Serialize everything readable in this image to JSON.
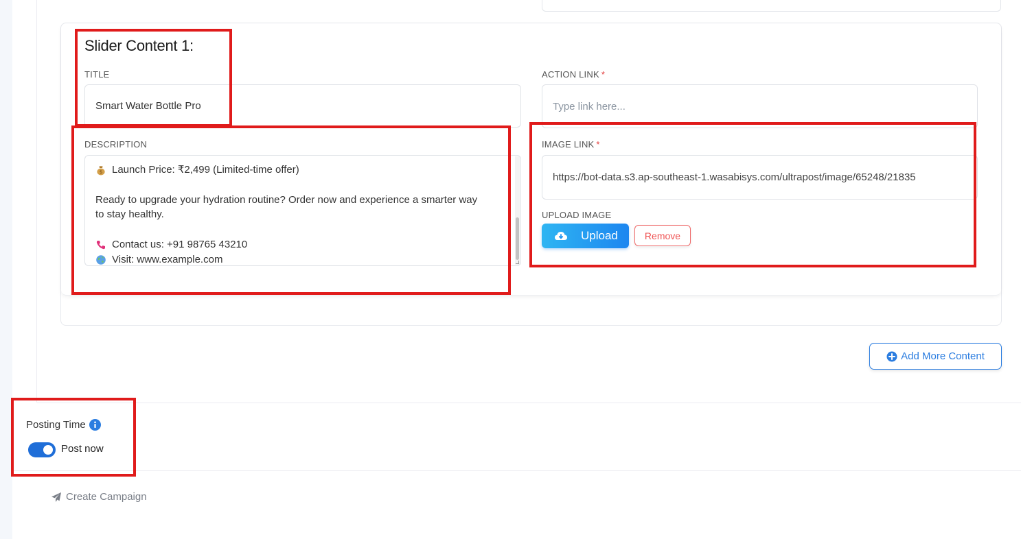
{
  "slider": {
    "heading": "Slider Content 1:",
    "title_label": "TITLE",
    "title_value": "Smart Water Bottle Pro",
    "action_link_label": "ACTION LINK",
    "action_link_placeholder": "Type link here...",
    "required_mark": "*",
    "description_label": "DESCRIPTION",
    "description_lines": {
      "line1": "Launch Price: ₹2,499 (Limited-time offer)",
      "line2": "Ready to upgrade your hydration routine? Order now and experience a smarter way",
      "line3": "to stay healthy.",
      "line4": "Contact us: +91 98765 43210",
      "line5": "Visit: www.example.com"
    },
    "image_link_label": "IMAGE LINK",
    "image_link_value": "https://bot-data.s3.ap-southeast-1.wasabisys.com/ultrapost/image/65248/21835",
    "upload_image_label": "UPLOAD IMAGE",
    "upload_button": "Upload",
    "remove_button": "Remove"
  },
  "add_more_button": "Add More Content",
  "posting": {
    "label": "Posting Time",
    "toggle_label": "Post now",
    "toggle_on": true
  },
  "create_campaign": "Create Campaign",
  "colors": {
    "primary": "#1f6ed8",
    "annotation_red": "#e01b1b",
    "remove_red": "#ef5353"
  },
  "icons": {
    "money_bag": "money-bag-icon",
    "phone": "phone-icon",
    "globe": "globe-icon",
    "cloud": "cloud-download-icon",
    "plus_circle": "plus-circle-icon",
    "info": "info-icon",
    "send": "paper-plane-icon"
  }
}
